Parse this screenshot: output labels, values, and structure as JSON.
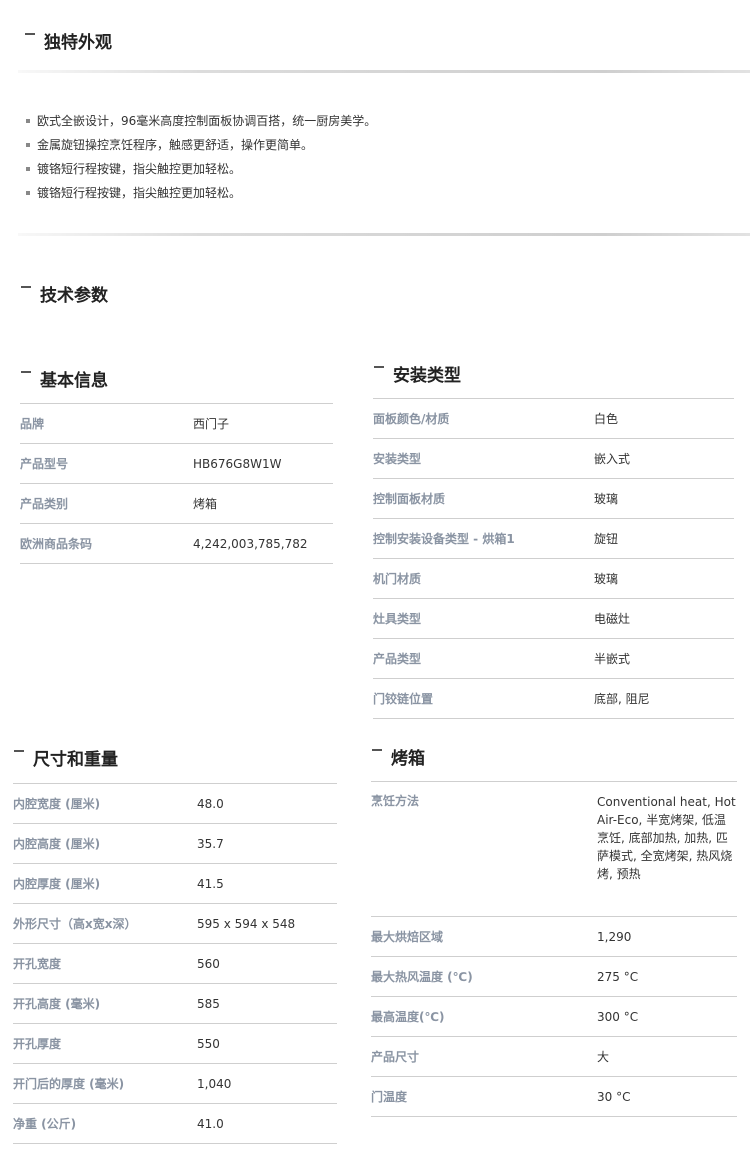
{
  "features": {
    "title": "独特外观",
    "items": [
      "欧式全嵌设计，96毫米高度控制面板协调百搭，统一厨房美学。",
      "金属旋钮操控烹饪程序，触感更舒适，操作更简单。",
      "镀铬短行程按键，指尖触控更加轻松。",
      "镀铬短行程按键，指尖触控更加轻松。"
    ]
  },
  "specs": {
    "title": "技术参数"
  },
  "basic_info": {
    "title": "基本信息",
    "rows": [
      {
        "key": "品牌",
        "value": "西门子"
      },
      {
        "key": "产品型号",
        "value": "HB676G8W1W"
      },
      {
        "key": "产品类别",
        "value": "烤箱"
      },
      {
        "key": "欧洲商品条码",
        "value": "4,242,003,785,782"
      }
    ]
  },
  "install_type": {
    "title": "安装类型",
    "rows": [
      {
        "key": "面板颜色/材质",
        "value": "白色"
      },
      {
        "key": "安装类型",
        "value": "嵌入式"
      },
      {
        "key": "控制面板材质",
        "value": "玻璃"
      },
      {
        "key": "控制安装设备类型 - 烘箱1",
        "value": "旋钮"
      },
      {
        "key": "机门材质",
        "value": "玻璃"
      },
      {
        "key": "灶具类型",
        "value": "电磁灶"
      },
      {
        "key": "产品类型",
        "value": "半嵌式"
      },
      {
        "key": "门铰链位置",
        "value": "底部, 阻尼"
      }
    ]
  },
  "dimensions": {
    "title": "尺寸和重量",
    "rows": [
      {
        "key": "内腔宽度 (厘米)",
        "value": "48.0"
      },
      {
        "key": "内腔高度 (厘米)",
        "value": "35.7"
      },
      {
        "key": "内腔厚度 (厘米)",
        "value": "41.5"
      },
      {
        "key": "外形尺寸（高x宽x深）",
        "value": "595 x 594 x 548"
      },
      {
        "key": "开孔宽度",
        "value": "560"
      },
      {
        "key": "开孔高度 (毫米)",
        "value": "585"
      },
      {
        "key": "开孔厚度",
        "value": "550"
      },
      {
        "key": "开门后的厚度 (毫米)",
        "value": "1,040"
      },
      {
        "key": "净重 (公斤)",
        "value": "41.0"
      }
    ]
  },
  "oven": {
    "title": "烤箱",
    "rows": [
      {
        "key": "烹饪方法",
        "value": "Conventional heat, Hot Air-Eco, 半宽烤架, 低温烹饪, 底部加热, 加热, 匹萨模式, 全宽烤架, 热风烧烤, 预热"
      },
      {
        "key": "最大烘焙区域",
        "value": "1,290"
      },
      {
        "key": "最大热风温度 (℃)",
        "value": "275 °C"
      },
      {
        "key": "最高温度(℃)",
        "value": "300 °C"
      },
      {
        "key": "产品尺寸",
        "value": "大"
      },
      {
        "key": "门温度",
        "value": "30 °C"
      }
    ]
  }
}
